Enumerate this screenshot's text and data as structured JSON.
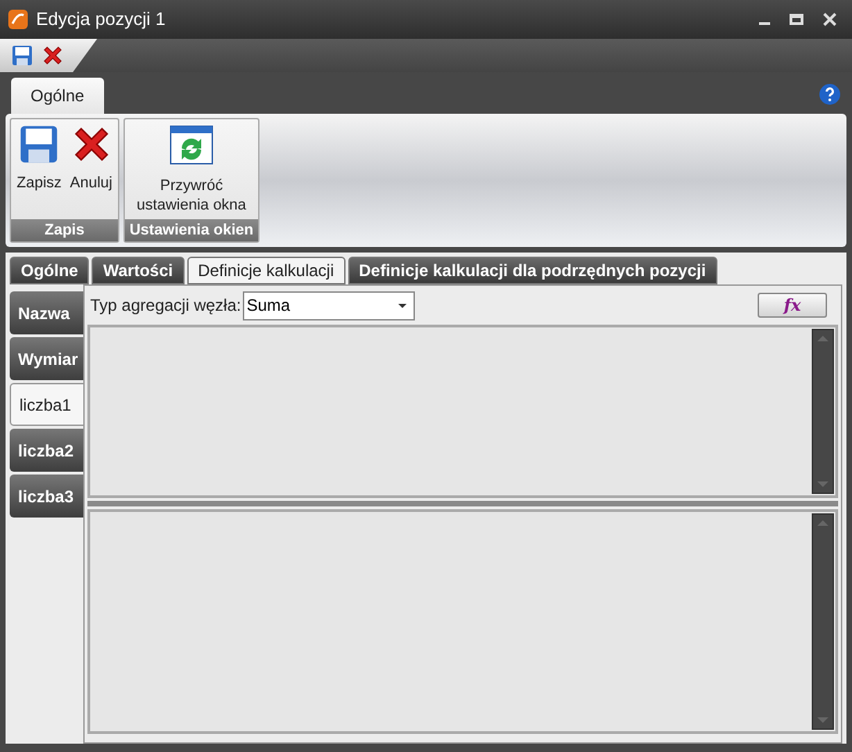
{
  "window": {
    "title": "Edycja pozycji 1"
  },
  "ribbon_tabs": [
    {
      "label": "Ogólne",
      "selected": true
    }
  ],
  "ribbon_groups": [
    {
      "label": "Zapis",
      "buttons": [
        {
          "label": "Zapisz",
          "kind": "save"
        },
        {
          "label": "Anuluj",
          "kind": "cancel"
        }
      ]
    },
    {
      "label": "Ustawienia okien",
      "buttons": [
        {
          "label": "Przywróć ustawienia okna",
          "kind": "restore"
        }
      ]
    }
  ],
  "tabs": [
    {
      "label": "Ogólne",
      "selected": false
    },
    {
      "label": "Wartości",
      "selected": false
    },
    {
      "label": "Definicje kalkulacji",
      "selected": true
    },
    {
      "label": "Definicje kalkulacji dla podrzędnych pozycji",
      "selected": false
    }
  ],
  "side_tabs": [
    {
      "label": "Nazwa",
      "selected": false
    },
    {
      "label": "Wymiar",
      "selected": false
    },
    {
      "label": "liczba1",
      "selected": true
    },
    {
      "label": "liczba2",
      "selected": false
    },
    {
      "label": "liczba3",
      "selected": false
    }
  ],
  "aggregation": {
    "label": "Typ agregacji węzła:",
    "value": "Suma"
  },
  "formula_button": {
    "label": "fx"
  }
}
